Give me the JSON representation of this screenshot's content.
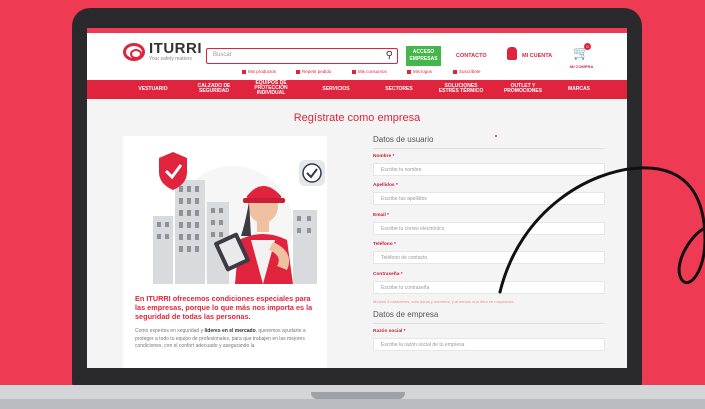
{
  "header": {
    "brand_name": "ITURRI",
    "brand_tagline": "Your safety matters",
    "search_placeholder": "Buscar",
    "acceso_line1": "ACCESO",
    "acceso_line2": "EMPRESAS",
    "contacto": "CONTACTO",
    "mi_cuenta": "MI CUENTA",
    "cart_count": "0",
    "mi_compra": "MI COMPRA"
  },
  "subnav": [
    "Mis productos",
    "Repetir pedido",
    "Mis consumos",
    "Mis logos",
    "Suscríbete"
  ],
  "nav": {
    "vestuario": "VESTUARIO",
    "calzado_1": "CALZADO DE",
    "calzado_2": "SEGURIDAD",
    "equipos_1": "EQUIPOS DE",
    "equipos_2": "PROTECCIÓN",
    "equipos_3": "INDIVIDUAL",
    "servicios": "SERVICIOS",
    "sectores": "SECTORES",
    "soluciones_1": "SOLUCIONES",
    "soluciones_2": "ESTRÉS TÉRMICO",
    "outlet_1": "OUTLET Y",
    "outlet_2": "PROMOCIONES",
    "marcas": "MARCAS"
  },
  "page": {
    "title": "Regístrate como empresa",
    "card_heading": "En ITURRI ofrecemos condiciones especiales para las empresas, porque lo que más nos importa es la seguridad de todas las personas.",
    "card_body_1": "Como expertos en seguridad y ",
    "card_body_bold": "líderes en el mercado",
    "card_body_2": ", queremos ayudarte a proteger a todo tu equipo de profesionales, para que trabajen en las mejores condiciones, con el confort adecuado y asegurando la"
  },
  "form": {
    "user_section": "Datos de usuario",
    "nombre_label": "Nombre *",
    "nombre_ph": "Escribe tu nombre",
    "apellidos_label": "Apellidos *",
    "apellidos_ph": "Escribe tus apellidos",
    "email_label": "Email *",
    "email_ph": "Escribe tu correo electrónico",
    "telefono_label": "Teléfono *",
    "telefono_ph": "Teléfono de contacto",
    "password_label": "Contraseña *",
    "password_ph": "Escribe tu contraseña",
    "password_hint": "Mínimo 8 caracteres, solo letras y números, y al menos una letra en mayúscula.",
    "company_section": "Datos de empresa",
    "razon_label": "Razón social *",
    "razon_ph": "Escribe la razón social de tu empresa"
  },
  "colors": {
    "background": "#ee3a52",
    "brand_red": "#e0243d",
    "acceso_green": "#45b649"
  }
}
